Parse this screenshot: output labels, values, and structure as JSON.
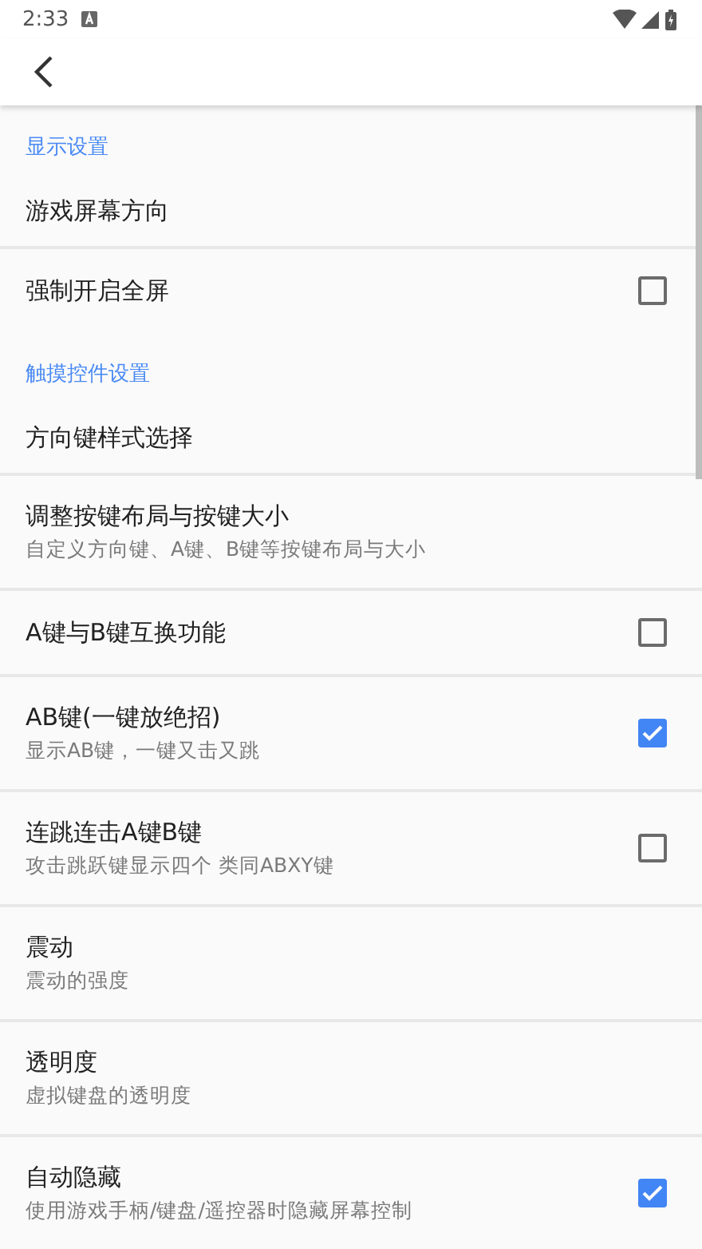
{
  "status_bar": {
    "time": "2:33"
  },
  "sections": [
    {
      "title": "显示设置",
      "items": [
        {
          "kind": "plain",
          "title": "游戏屏幕方向"
        },
        {
          "kind": "checkbox",
          "title": "强制开启全屏",
          "checked": false
        }
      ]
    },
    {
      "title": "触摸控件设置",
      "items": [
        {
          "kind": "plain",
          "title": "方向键样式选择"
        },
        {
          "kind": "plain",
          "title": "调整按键布局与按键大小",
          "summary": "自定义方向键、A键、B键等按键布局与大小"
        },
        {
          "kind": "checkbox",
          "title": "A键与B键互换功能",
          "checked": false
        },
        {
          "kind": "checkbox",
          "title": "AB键(一键放绝招)",
          "summary": "显示AB键，一键又击又跳",
          "checked": true
        },
        {
          "kind": "checkbox",
          "title": "连跳连击A键B键",
          "summary": "攻击跳跃键显示四个 类同ABXY键",
          "checked": false
        },
        {
          "kind": "plain",
          "title": "震动",
          "summary": "震动的强度"
        },
        {
          "kind": "plain",
          "title": "透明度",
          "summary": "虚拟键盘的透明度"
        },
        {
          "kind": "checkbox",
          "title": "自动隐藏",
          "summary": "使用游戏手柄/键盘/遥控器时隐藏屏幕控制",
          "checked": true
        }
      ]
    }
  ]
}
